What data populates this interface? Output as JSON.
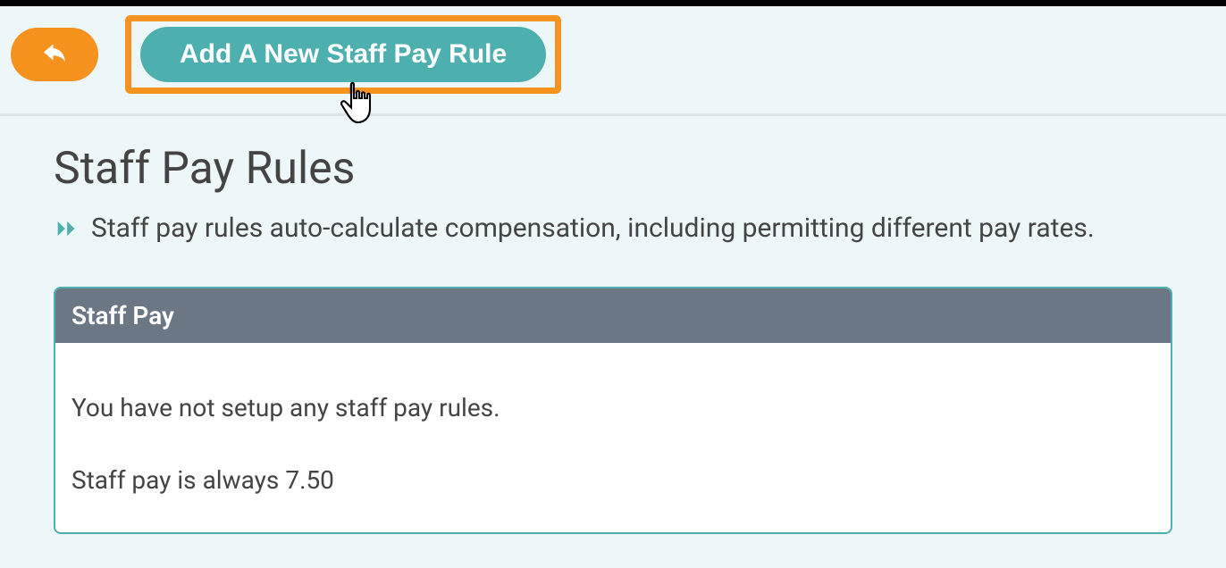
{
  "toolbar": {
    "add_label": "Add A New Staff Pay Rule"
  },
  "page": {
    "title": "Staff Pay Rules",
    "description": "Staff pay rules auto-calculate compensation, including permitting different pay rates."
  },
  "panel": {
    "header": "Staff Pay",
    "line1": "You have not setup any staff pay rules.",
    "line2": "Staff pay is always 7.50"
  }
}
